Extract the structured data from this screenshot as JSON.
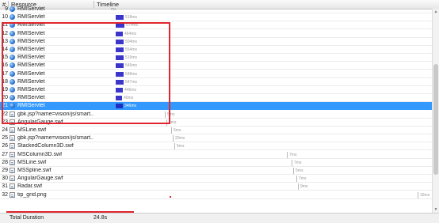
{
  "header": {
    "index_label": "#",
    "resource_label": "Resource",
    "timeline_label": "Timeline"
  },
  "rows": [
    {
      "num": "9",
      "icon": "globe",
      "name": "RMIServlet",
      "kind": "bar",
      "bar_frac": 0,
      "time": "ms"
    },
    {
      "num": "10",
      "icon": "globe",
      "name": "RMIServlet",
      "kind": "bar",
      "bar_frac": 0.55,
      "time": "518ms"
    },
    {
      "num": "11",
      "icon": "globe",
      "name": "RMIServlet",
      "kind": "bar",
      "bar_frac": 0.6,
      "time": "574ms"
    },
    {
      "num": "12",
      "icon": "globe",
      "name": "RMIServlet",
      "kind": "bar",
      "bar_frac": 0.5,
      "time": "464ms"
    },
    {
      "num": "13",
      "icon": "globe",
      "name": "RMIServlet",
      "kind": "bar",
      "bar_frac": 0.56,
      "time": "504ms"
    },
    {
      "num": "14",
      "icon": "globe",
      "name": "RMIServlet",
      "kind": "bar",
      "bar_frac": 0.58,
      "time": "554ms"
    },
    {
      "num": "15",
      "icon": "globe",
      "name": "RMIServlet",
      "kind": "bar",
      "bar_frac": 0.55,
      "time": "519ms"
    },
    {
      "num": "16",
      "icon": "globe",
      "name": "RMIServlet",
      "kind": "bar",
      "bar_frac": 0.57,
      "time": "545ms"
    },
    {
      "num": "17",
      "icon": "globe",
      "name": "RMIServlet",
      "kind": "bar",
      "bar_frac": 0.57,
      "time": "548ms"
    },
    {
      "num": "18",
      "icon": "globe",
      "name": "RMIServlet",
      "kind": "bar",
      "bar_frac": 0.58,
      "time": "547ms"
    },
    {
      "num": "19",
      "icon": "globe",
      "name": "RMIServlet",
      "kind": "bar",
      "bar_frac": 0.48,
      "time": "446ms"
    },
    {
      "num": "20",
      "icon": "globe",
      "name": "RMIServlet",
      "kind": "bar",
      "bar_frac": 0.44,
      "time": "40ms"
    },
    {
      "num": "21",
      "icon": "globe",
      "name": "RMIServlet",
      "kind": "bar",
      "bar_frac": 0.5,
      "time": "346ms",
      "selected": true
    },
    {
      "num": "22",
      "icon": "file",
      "name": "gbk.jsp?name=vision/js/smart...",
      "kind": "tick",
      "time": "5ms"
    },
    {
      "num": "23",
      "icon": "file",
      "name": "AngularGauge.swf",
      "kind": "tick",
      "time": "5ms"
    },
    {
      "num": "24",
      "icon": "file",
      "name": "MSLine.swf",
      "kind": "tick",
      "time": "5ms"
    },
    {
      "num": "25",
      "icon": "file",
      "name": "gbk.jsp?name=vision/js/smart...",
      "kind": "tick",
      "time": "20ms"
    },
    {
      "num": "26",
      "icon": "file",
      "name": "StackedColumn3D.swf",
      "kind": "tick",
      "time": "5ms"
    },
    {
      "num": "27",
      "icon": "file",
      "name": "MSColumn3D.swf",
      "kind": "tick",
      "time": "7ms"
    },
    {
      "num": "28",
      "icon": "file",
      "name": "MSLine.swf",
      "kind": "tick",
      "time": "7ms"
    },
    {
      "num": "29",
      "icon": "file",
      "name": "MSSpline.swf",
      "kind": "tick",
      "time": "5ms"
    },
    {
      "num": "30",
      "icon": "file",
      "name": "AngularGauge.swf",
      "kind": "tick",
      "time": "7ms"
    },
    {
      "num": "31",
      "icon": "file",
      "name": "Radar.swf",
      "kind": "tick",
      "time": "9ms"
    },
    {
      "num": "32",
      "icon": "file",
      "name": "tip_grid.png",
      "kind": "tick",
      "time": "16ms"
    }
  ],
  "footer": {
    "label": "Total Duration",
    "value": "24.8s"
  },
  "colors": {
    "selection": "#3399ff",
    "bar": "#3b36c9",
    "highlight": "#e0262e"
  }
}
